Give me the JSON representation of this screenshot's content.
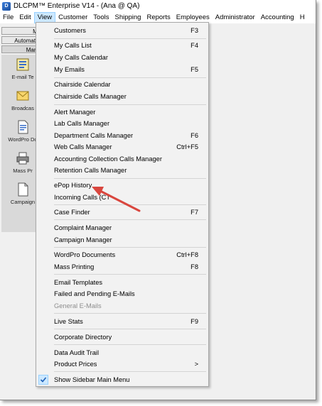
{
  "window": {
    "title": "DLCPM™ Enterprise V14 - (Ana @ QA)",
    "icon": "dlcpm-app-icon"
  },
  "menubar": [
    "File",
    "Edit",
    "View",
    "Customer",
    "Tools",
    "Shipping",
    "Reports",
    "Employees",
    "Administrator",
    "Accounting",
    "H"
  ],
  "sidebar": {
    "tabs": [
      "Mai",
      "Automated",
      "Marke"
    ],
    "items": [
      "E-mail Te",
      "Broadcas",
      "WordPro Do",
      "Mass Pr",
      "Campaign"
    ]
  },
  "view_menu": {
    "items": [
      {
        "label": "Customers",
        "shortcut": "F3"
      },
      {
        "label": "My Calls List",
        "shortcut": "F4"
      },
      {
        "label": "My Calls Calendar",
        "shortcut": ""
      },
      {
        "label": "My Emails",
        "shortcut": "F5"
      },
      {
        "label": "Chairside Calendar",
        "shortcut": ""
      },
      {
        "label": "Chairside Calls Manager",
        "shortcut": ""
      },
      {
        "label": "Alert Manager",
        "shortcut": ""
      },
      {
        "label": "Lab Calls Manager",
        "shortcut": ""
      },
      {
        "label": "Department Calls Manager",
        "shortcut": "F6"
      },
      {
        "label": "Web Calls Manager",
        "shortcut": "Ctrl+F5"
      },
      {
        "label": "Accounting Collection Calls Manager",
        "shortcut": ""
      },
      {
        "label": "Retention Calls Manager",
        "shortcut": ""
      },
      {
        "label": "ePop History",
        "shortcut": ""
      },
      {
        "label": "Incoming Calls (CT",
        "shortcut": ""
      },
      {
        "label": "Case Finder",
        "shortcut": "F7"
      },
      {
        "label": "Complaint Manager",
        "shortcut": ""
      },
      {
        "label": "Campaign Manager",
        "shortcut": ""
      },
      {
        "label": "WordPro Documents",
        "shortcut": "Ctrl+F8"
      },
      {
        "label": "Mass Printing",
        "shortcut": "F8"
      },
      {
        "label": "Email Templates",
        "shortcut": ""
      },
      {
        "label": "Failed and Pending E-Mails",
        "shortcut": ""
      },
      {
        "label": "General E-Mails",
        "shortcut": ""
      },
      {
        "label": "Live Stats",
        "shortcut": "F9"
      },
      {
        "label": "Corporate Directory",
        "shortcut": ""
      },
      {
        "label": "Data Audit Trail",
        "shortcut": ""
      },
      {
        "label": "Product Prices",
        "shortcut": ">"
      },
      {
        "label": "Show Sidebar Main Menu",
        "shortcut": ""
      }
    ]
  },
  "colors": {
    "menu_highlight": "#cce8ff",
    "annotation_arrow": "#d9463e",
    "disabled_text": "#8d8d8d"
  }
}
